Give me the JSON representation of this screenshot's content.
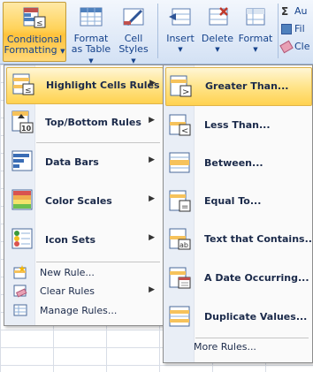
{
  "ribbon": {
    "conditional_formatting": {
      "line1": "Conditional",
      "line2": "Formatting"
    },
    "format_as_table": {
      "line1": "Format",
      "line2": "as Table"
    },
    "cell_styles": {
      "line1": "Cell",
      "line2": "Styles"
    },
    "insert": "Insert",
    "delete": "Delete",
    "format": "Format",
    "small": [
      {
        "label": "Au",
        "icon": "sigma-icon"
      },
      {
        "label": "Fil",
        "icon": "fill-icon"
      },
      {
        "label": "Cle",
        "icon": "eraser-icon"
      }
    ]
  },
  "menu": {
    "items": [
      {
        "label": "Highlight Cells Rules",
        "icon": "highlight-cells-icon",
        "submenu": true
      },
      {
        "label": "Top/Bottom Rules",
        "icon": "top-bottom-icon",
        "submenu": true
      },
      {
        "label": "Data Bars",
        "icon": "data-bars-icon",
        "submenu": true
      },
      {
        "label": "Color Scales",
        "icon": "color-scales-icon",
        "submenu": true
      },
      {
        "label": "Icon Sets",
        "icon": "icon-sets-icon",
        "submenu": true
      }
    ],
    "small_items": [
      {
        "label": "New Rule...",
        "icon": "new-rule-icon",
        "submenu": false
      },
      {
        "label": "Clear Rules",
        "icon": "clear-rules-icon",
        "submenu": true
      },
      {
        "label": "Manage Rules...",
        "icon": "manage-rules-icon",
        "submenu": false
      }
    ]
  },
  "submenu": {
    "items": [
      {
        "label": "Greater Than...",
        "icon": "greater-than-icon"
      },
      {
        "label": "Less Than...",
        "icon": "less-than-icon"
      },
      {
        "label": "Between...",
        "icon": "between-icon"
      },
      {
        "label": "Equal To...",
        "icon": "equal-to-icon"
      },
      {
        "label": "Text that Contains...",
        "icon": "text-contains-icon"
      },
      {
        "label": "A Date Occurring...",
        "icon": "date-occurring-icon"
      },
      {
        "label": "Duplicate Values...",
        "icon": "duplicate-values-icon"
      }
    ],
    "more": "More Rules..."
  },
  "colors": {
    "highlight": "#ffd250",
    "menu_bg": "#fafafa",
    "ribbon_bg": "#dce6f4",
    "text": "#1b2a4a"
  }
}
